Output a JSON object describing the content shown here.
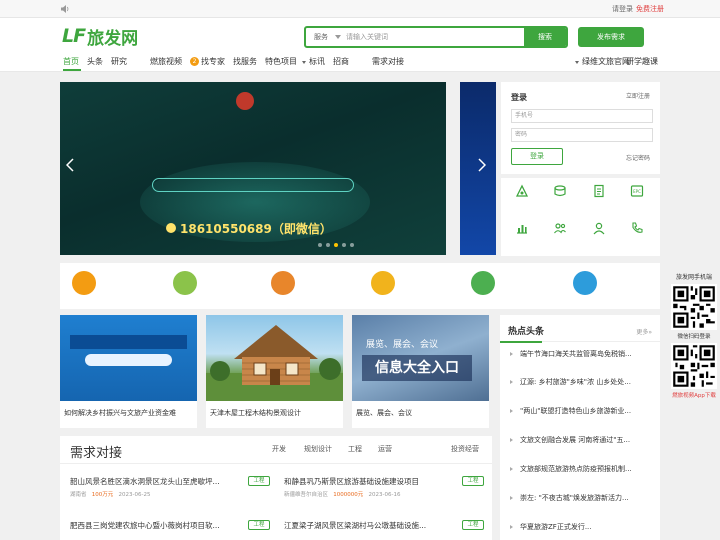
{
  "topbar": {
    "notice": "",
    "login": "请登录",
    "register": "免费注册"
  },
  "header": {
    "logo_mark": "LF",
    "logo_text": "旅发网",
    "tagline": "",
    "search": {
      "category": "服务",
      "placeholder": "请输入关键词",
      "button": "搜索"
    },
    "post_button": "发布需求"
  },
  "nav": {
    "items": [
      "首页",
      "头条",
      "研究",
      "燃旅视频",
      "找专家",
      "找服务",
      "特色项目",
      "标讯",
      "招商",
      "需求对接",
      "",
      "",
      "",
      "",
      "绿维文旅官网",
      "研学趣课"
    ],
    "badge": "2"
  },
  "banner": {
    "line1": "",
    "headline": "",
    "slogan": "",
    "services": "",
    "phone": "18610550689（即微信）"
  },
  "login": {
    "title": "登录",
    "register": "立即注册",
    "phone_placeholder": "手机号",
    "password_placeholder": "密码",
    "button": "登录",
    "forgot": "忘记密码"
  },
  "quick_icons": [
    "",
    "",
    "",
    "",
    "",
    "",
    "",
    ""
  ],
  "stats": [
    {
      "name": "",
      "value": "",
      "color": "#f39c12"
    },
    {
      "name": "",
      "value": "",
      "color": "#8bc34a"
    },
    {
      "name": "",
      "value": "",
      "color": "#e8862b"
    },
    {
      "name": "",
      "value": "",
      "color": "#f1b31c"
    },
    {
      "name": "",
      "value": "",
      "color": "#4caf50"
    },
    {
      "name": "",
      "value": "",
      "color": "#2d9cdb"
    }
  ],
  "cards": [
    {
      "title": "如何解决乡村振兴与文旅产业资金难",
      "sub": "",
      "img_head": "",
      "img_head2": "",
      "img_sub": "",
      "img_date": ""
    },
    {
      "title": "天津木屋工程木结构景观设计",
      "sub": ""
    },
    {
      "title": "展览、展会、会议",
      "sub": "",
      "img_top": "展览、展会、会议",
      "img_big": "信息大全入口"
    }
  ],
  "demand": {
    "title": "需求对接",
    "tabs": [
      "开发",
      "规划设计",
      "工程",
      "运营",
      "",
      "投资经营"
    ],
    "rows": [
      {
        "title": "韶山风景名胜区滴水洞景区龙头山至虎歇坪...",
        "tag": "工程",
        "location": "湖南省",
        "price": "100万元",
        "date": "2023-06-25"
      },
      {
        "title": "和静县巩乃斯景区旅游基础设施建设项目",
        "tag": "工程",
        "location": "新疆维吾尔自治区",
        "price": "1000000元",
        "date": "2023-06-16"
      },
      {
        "title": "肥西县三岗党建农旅中心暨小薇岗村项目软...",
        "tag": "工程",
        "location": "",
        "price": "",
        "date": ""
      },
      {
        "title": "江夏梁子湖风景区梁湖村马公墩基础设施...",
        "tag": "工程",
        "location": "",
        "price": "",
        "date": ""
      }
    ]
  },
  "hot": {
    "title": "热点头条",
    "more": "更多»",
    "items": [
      {
        "title": "端午节海口海关共监管离岛免税销...",
        "date": "",
        "source": ""
      },
      {
        "title": "辽源: 乡村旅游\"乡味\"浓 山乡处处...",
        "date": "",
        "source": ""
      },
      {
        "title": "\"两山\"联盟打造特色山乡旅游新业...",
        "date": "",
        "source": ""
      },
      {
        "title": "文旅文创融合发展 河南将通过\"五...",
        "date": "",
        "source": ""
      },
      {
        "title": "文旅部规范旅游热点防疫预报机制...",
        "date": "",
        "source": ""
      },
      {
        "title": "崇左: \"不夜古城\"焕发旅游新活力...",
        "date": "",
        "source": ""
      },
      {
        "title": "华夏旅游ZF正式发行...",
        "date": "",
        "source": ""
      }
    ]
  },
  "qr": {
    "app_title": "旅发网手机端",
    "wechat_caption": "微信扫码登录",
    "video_caption": "燃旅视频App下载"
  }
}
